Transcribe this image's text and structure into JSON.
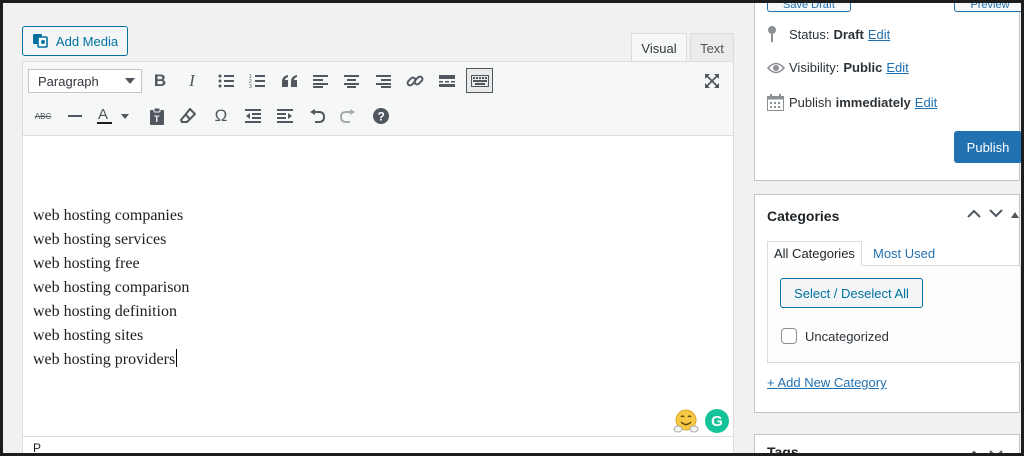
{
  "toolbar": {
    "add_media_label": "Add Media",
    "tabs": [
      {
        "label": "Visual"
      },
      {
        "label": "Text"
      }
    ],
    "format_select_value": "Paragraph",
    "buttons": [
      "bold",
      "italic",
      "bulleted-list",
      "numbered-list",
      "blockquote",
      "align-left",
      "align-center",
      "align-right",
      "insert-link",
      "read-more",
      "toolbar-toggle",
      "fullscreen",
      "strikethrough",
      "horizontal-line",
      "text-color",
      "paste-as-text",
      "clear-formatting",
      "special-character",
      "outdent",
      "indent",
      "undo",
      "redo",
      "keyboard-shortcuts"
    ]
  },
  "editor": {
    "lines": [
      "web hosting companies",
      "web hosting services",
      "web hosting free",
      "web hosting comparison",
      "web hosting definition",
      "web hosting sites",
      "web hosting providers"
    ],
    "path": "P"
  },
  "publish": {
    "save_draft_label": "Save Draft",
    "preview_label": "Preview",
    "status_label": "Status:",
    "status_value": "Draft",
    "visibility_label": "Visibility:",
    "visibility_value": "Public",
    "publish_label": "Publish",
    "publish_value": "immediately",
    "edit_label": "Edit",
    "publish_button": "Publish"
  },
  "categories": {
    "title": "Categories",
    "tabs": [
      {
        "label": "All Categories"
      },
      {
        "label": "Most Used"
      }
    ],
    "select_button": "Select / Deselect All",
    "items": [
      {
        "label": "Uncategorized",
        "checked": false
      }
    ],
    "add_new": "+ Add New Category"
  },
  "tags": {
    "title": "Tags"
  },
  "colors": {
    "accent": "#2271b1",
    "grammarly": "#15c39a"
  }
}
